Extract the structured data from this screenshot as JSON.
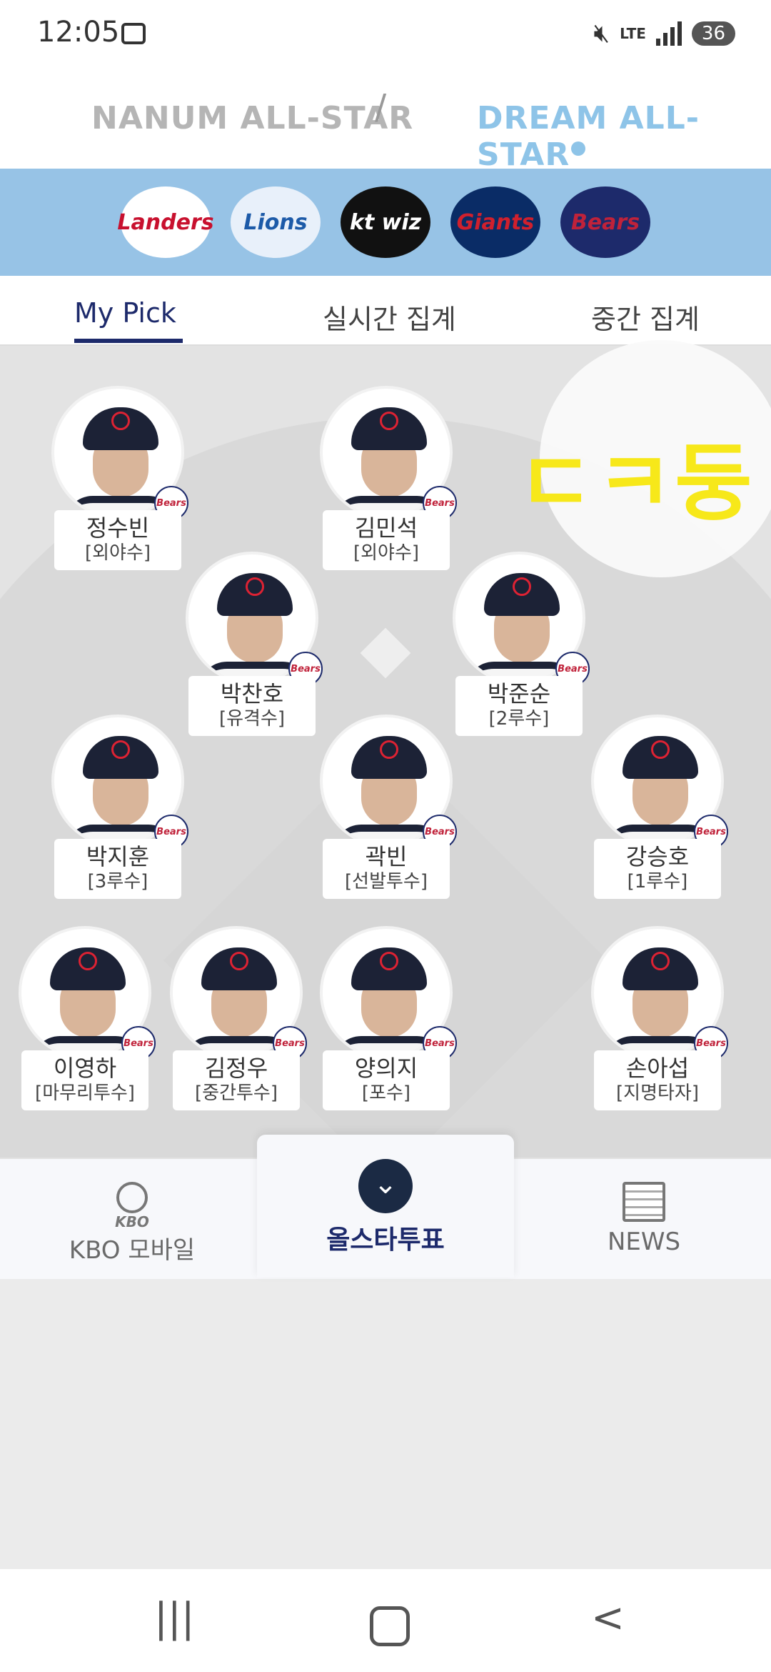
{
  "status": {
    "time": "12:05",
    "network": "LTE",
    "battery": "36"
  },
  "header": {
    "left_logo": "NANUM ALL-STAR",
    "separator": "/",
    "right_logo": "DREAM ALL-STAR"
  },
  "teams": [
    {
      "name": "Landers",
      "color": "#c8102e",
      "bg": "#ffffff"
    },
    {
      "name": "Lions",
      "color": "#1c5aa8",
      "bg": "#e8f0fa"
    },
    {
      "name": "kt wiz",
      "color": "#ffffff",
      "bg": "#111111"
    },
    {
      "name": "Giants",
      "color": "#d0202d",
      "bg": "#0a2c66"
    },
    {
      "name": "Bears",
      "color": "#c0223a",
      "bg": "#1d2a6b"
    }
  ],
  "tabs": {
    "my_pick": "My Pick",
    "realtime": "실시간 집계",
    "midterm": "중간 집계"
  },
  "players": [
    {
      "name": "정수빈",
      "pos": "[외야수]"
    },
    {
      "name": "김민석",
      "pos": "[외야수]"
    },
    {
      "name": "박찬호",
      "pos": "[유격수]"
    },
    {
      "name": "박준순",
      "pos": "[2루수]"
    },
    {
      "name": "박지훈",
      "pos": "[3루수]"
    },
    {
      "name": "곽빈",
      "pos": "[선발투수]"
    },
    {
      "name": "강승호",
      "pos": "[1루수]"
    },
    {
      "name": "이영하",
      "pos": "[마무리투수]"
    },
    {
      "name": "김정우",
      "pos": "[중간투수]"
    },
    {
      "name": "양의지",
      "pos": "[포수]"
    },
    {
      "name": "손아섭",
      "pos": "[지명타자]"
    }
  ],
  "badge": "Bears",
  "overlay": "ㄷㅋ둥",
  "bottom_nav": {
    "kbo_small": "KBO",
    "kbo": "KBO 모바일",
    "vote": "올스타투표",
    "news": "NEWS"
  },
  "colors": {
    "navy": "#1d2a6b",
    "sky": "#97c3e6",
    "highlight": "#f7e81a"
  }
}
